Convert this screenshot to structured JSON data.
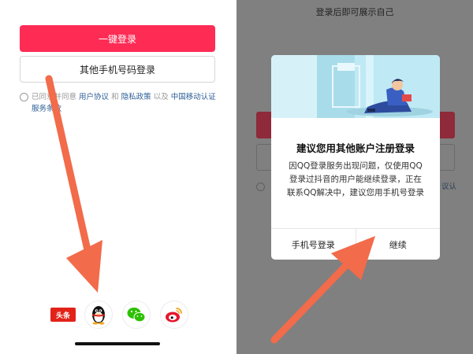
{
  "left": {
    "one_click_login": "一键登录",
    "other_phone_login": "其他手机号码登录",
    "agreement": {
      "prefix": "已同意并同意",
      "user_agreement": "用户协议",
      "and": "和",
      "privacy_policy": "隐私政策",
      "also": "以及",
      "cmcc_terms": "中国移动认证服务条款"
    },
    "social": {
      "toutiao_label": "头条"
    }
  },
  "right": {
    "top_text": "登录后即可展示自己",
    "dialog": {
      "title": "建议您用其他账户注册登录",
      "body": "因QQ登录服务出现问题，仅使用QQ登录过抖音的用户能继续登录，正在联系QQ解决中，建议您用手机号登录",
      "phone_login": "手机号登录",
      "continue": "继续"
    },
    "bg_fragment": "议认"
  },
  "colors": {
    "primary": "#fe2c55",
    "link": "#2b5e95",
    "arrow": "#f26b4a",
    "overlay": "#808080"
  }
}
